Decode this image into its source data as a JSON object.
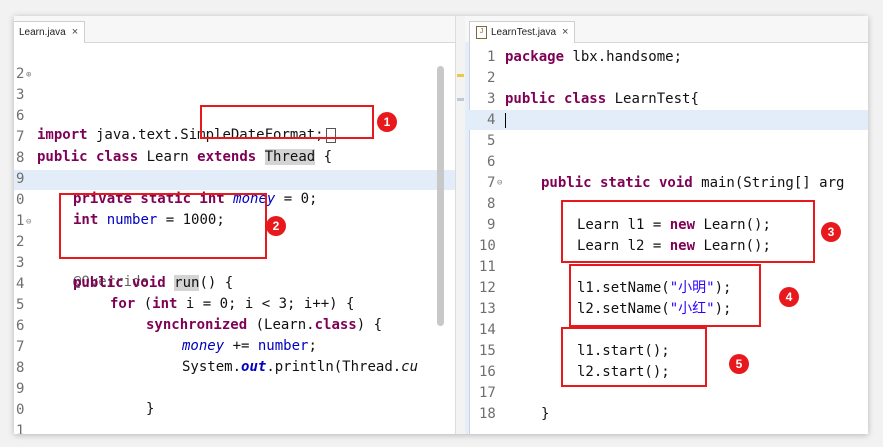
{
  "left_tab": {
    "label": "Learn.java",
    "close": "×"
  },
  "right_tab": {
    "label": "LearnTest.java",
    "close": "×"
  },
  "left_lines": [
    {
      "n": "2"
    },
    {
      "n": "3"
    },
    {
      "n": "6"
    },
    {
      "n": "7"
    },
    {
      "n": "8"
    },
    {
      "n": "9"
    },
    {
      "n": "0"
    },
    {
      "n": "1"
    },
    {
      "n": "2"
    },
    {
      "n": "3"
    },
    {
      "n": "4"
    },
    {
      "n": "5"
    },
    {
      "n": "6"
    },
    {
      "n": "7"
    },
    {
      "n": "8"
    },
    {
      "n": "9"
    },
    {
      "n": "0"
    },
    {
      "n": "1"
    }
  ],
  "left_code": {
    "l3_kw": "import",
    "l3_rest": " java.text.SimpleDateFormat;",
    "l7_a": "public class",
    "l7_b": " Learn ",
    "l7_c": "extends",
    "l7_d": " ",
    "l7_e": "Thread",
    "l7_f": " {",
    "l9_kw": "private static int",
    "l9_fld": "money",
    "l9_rest": " = 0;",
    "l10_kw": "int",
    "l10_fld": "number",
    "l10_rest": " = 1000;",
    "l12_ann": "@Override",
    "l13_kw": "public void",
    "l13_b": " ",
    "l13_run": "run",
    "l13_rest": "() {",
    "l14_kw": "for",
    "l14_rest1": " (",
    "l14_kw2": "int",
    "l14_rest2": " i = 0; i < 3; i++) {",
    "l15_kw": "synchronized",
    "l15_rest1": " (Learn.",
    "l15_kw2": "class",
    "l15_rest2": ") {",
    "l16_fld": "money",
    "l16_mid": " += ",
    "l16_fld2": "number",
    "l16_rest": ";",
    "l17_a": "System.",
    "l17_out": "out",
    "l17_b": ".println(Thread.",
    "l17_c": "cu",
    "l19": "}",
    "l21": "}"
  },
  "right_lines": [
    "1",
    "2",
    "3",
    "4",
    "5",
    "6",
    "7",
    "8",
    "9",
    "10",
    "11",
    "12",
    "13",
    "14",
    "15",
    "16",
    "17",
    "18"
  ],
  "right_code": {
    "r1_kw": "package",
    "r1_rest": " lbx.handsome;",
    "r3_kw": "public class",
    "r3_rest": " LearnTest{",
    "r7_kw": "public static void",
    "r7_rest": " main(String[] arg",
    "r9_a": "Learn l1 = ",
    "r9_kw": "new",
    "r9_b": " Learn();",
    "r10_a": "Learn l2 = ",
    "r10_kw": "new",
    "r10_b": " Learn();",
    "r12_a": "l1.setName(",
    "r12_str": "\"小明\"",
    "r12_b": ");",
    "r13_a": "l2.setName(",
    "r13_str": "\"小红\"",
    "r13_b": ");",
    "r15": "l1.start();",
    "r16": "l2.start();",
    "r18": "}"
  },
  "badges": [
    "1",
    "2",
    "3",
    "4",
    "5"
  ],
  "colors": {
    "callout": "#e8191c",
    "keyword": "#7f0055",
    "field": "#0000c0",
    "string": "#2a00ff",
    "current_line": "#e3ecf9"
  }
}
